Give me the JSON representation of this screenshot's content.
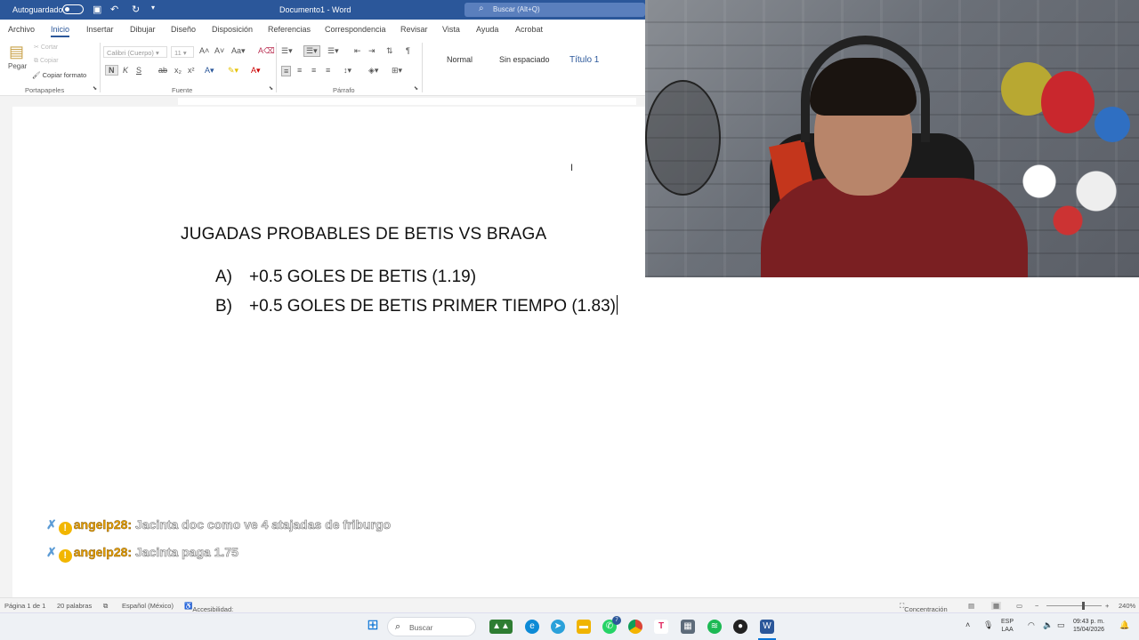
{
  "titlebar": {
    "autosave_label": "Autoguardado",
    "doc_title": "Documento1 - Word",
    "search_placeholder": "Buscar (Alt+Q)"
  },
  "menu": [
    "Archivo",
    "Inicio",
    "Insertar",
    "Dibujar",
    "Diseño",
    "Disposición",
    "Referencias",
    "Correspondencia",
    "Revisar",
    "Vista",
    "Ayuda",
    "Acrobat"
  ],
  "ribbon": {
    "paste": "Pegar",
    "cut": "Cortar",
    "copy": "Copiar",
    "format_painter": "Copiar formato",
    "font_name": "Calibri (Cuerpo)",
    "font_size": "11",
    "groups": {
      "clipboard": "Portapapeles",
      "font": "Fuente",
      "paragraph": "Párrafo"
    },
    "styles": [
      "Normal",
      "Sin espaciado",
      "Título 1"
    ]
  },
  "document": {
    "heading": "JUGADAS PROBABLES DE BETIS VS BRAGA",
    "items": [
      {
        "label": "A)",
        "text": "+0.5 GOLES DE BETIS (1.19)"
      },
      {
        "label": "B)",
        "text": "+0.5 GOLES DE BETIS PRIMER TIEMPO (1.83)"
      }
    ]
  },
  "chat": [
    {
      "user": "angelp28:",
      "message": "Jacinta doc como ve 4 atajadas de friburgo"
    },
    {
      "user": "angelp28:",
      "message": "Jacinta paga 1.75"
    }
  ],
  "statusbar": {
    "page": "Página 1 de 1",
    "words": "20 palabras",
    "language": "Español (México)",
    "accessibility": "Accesibilidad: todo correcto",
    "focus": "Concentración",
    "zoom": "240%"
  },
  "taskbar": {
    "search_placeholder": "Buscar",
    "lang_line1": "ESP",
    "lang_line2": "LAA",
    "time": "09:43 p. m.",
    "date": "15/04/2026",
    "whatsapp_badge": "7"
  },
  "colors": {
    "word_blue": "#2b579a",
    "taskbar": "#eef1f5"
  }
}
